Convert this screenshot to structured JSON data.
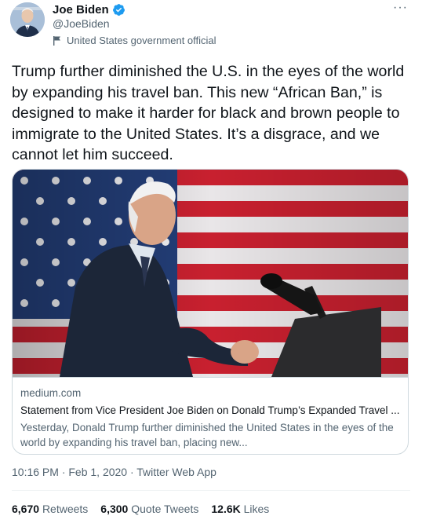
{
  "user": {
    "name": "Joe Biden",
    "handle": "@JoeBiden",
    "label": "United States government official",
    "verified_color": "#1d9bf0"
  },
  "menu": {
    "more_label": "···"
  },
  "tweet": {
    "text": "Trump further diminished the U.S. in the eyes of the world by expanding his travel ban. This new “African Ban,” is designed to make it harder for black and brown people to immigrate to the United States. It’s a disgrace, and we cannot let him succeed.",
    "timestamp": "10:16 PM · Feb 1, 2020 · Twitter Web App"
  },
  "card": {
    "domain": "medium.com",
    "title": "Statement from Vice President Joe Biden on Donald Trump’s Expanded Travel ...",
    "description": "Yesterday, Donald Trump further diminished the United States in the eyes of the world by expanding his travel ban, placing new..."
  },
  "stats": [
    {
      "count": "6,670",
      "label": "Retweets"
    },
    {
      "count": "6,300",
      "label": "Quote Tweets"
    },
    {
      "count": "12.6K",
      "label": "Likes"
    }
  ]
}
